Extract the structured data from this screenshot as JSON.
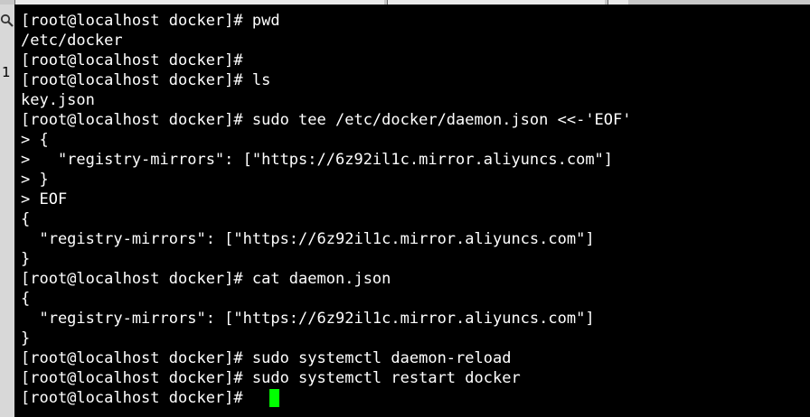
{
  "window": {
    "tabs": [
      "tab",
      "tab",
      "tab"
    ]
  },
  "sidebar": {
    "search_icon": "search-icon",
    "label": "1"
  },
  "terminal": {
    "lines": [
      "[root@localhost docker]# pwd",
      "/etc/docker",
      "[root@localhost docker]#",
      "[root@localhost docker]# ls",
      "key.json",
      "[root@localhost docker]# sudo tee /etc/docker/daemon.json <<-'EOF'",
      "> {",
      ">   \"registry-mirrors\": [\"https://6z92il1c.mirror.aliyuncs.com\"]",
      "> }",
      "> EOF",
      "{",
      "  \"registry-mirrors\": [\"https://6z92il1c.mirror.aliyuncs.com\"]",
      "}",
      "[root@localhost docker]# cat daemon.json",
      "{",
      "  \"registry-mirrors\": [\"https://6z92il1c.mirror.aliyuncs.com\"]",
      "}",
      "[root@localhost docker]# sudo systemctl daemon-reload",
      "[root@localhost docker]# sudo systemctl restart docker",
      "[root@localhost docker]#"
    ],
    "cursor_color": "#00ff00"
  }
}
